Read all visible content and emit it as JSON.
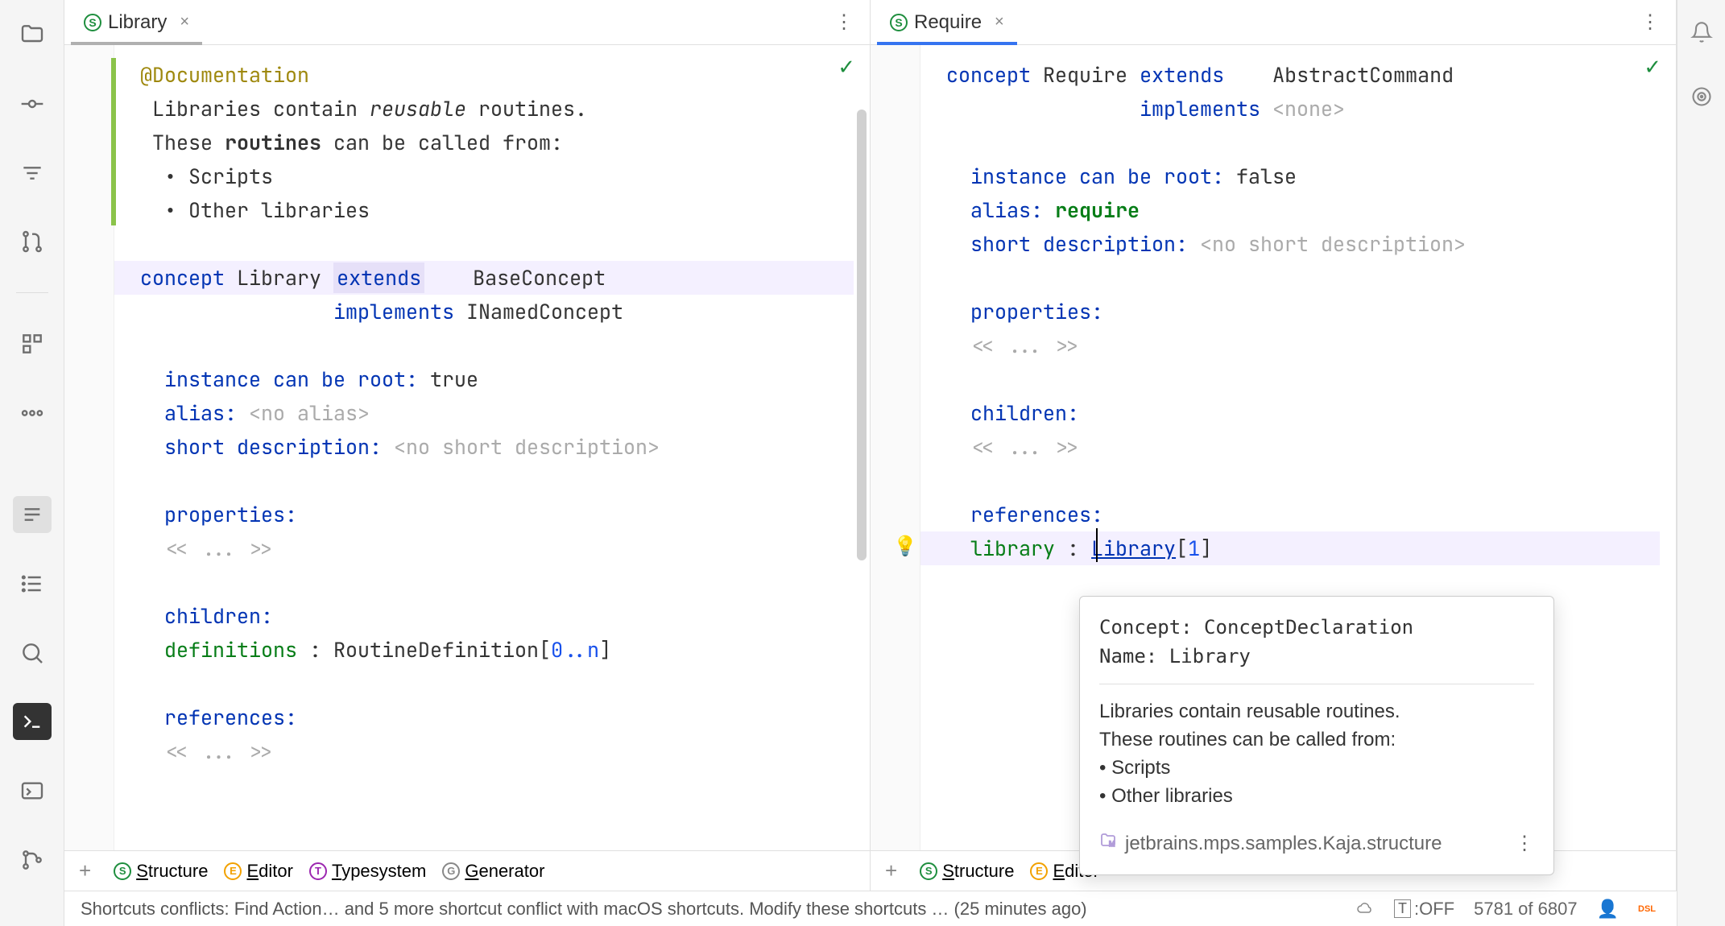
{
  "tabs": {
    "left": {
      "title": "Library",
      "icon": "S"
    },
    "right": {
      "title": "Require",
      "icon": "S"
    }
  },
  "left_editor": {
    "doc_annotation": "@Documentation",
    "doc_line1_pre": "Libraries contain ",
    "doc_line1_em": "reusable",
    "doc_line1_post": " routines.",
    "doc_line2_pre": "These ",
    "doc_line2_b": "routines",
    "doc_line2_post": " can be called from:",
    "doc_bullet1": "• Scripts",
    "doc_bullet2": "• Other libraries",
    "concept_kw": "concept",
    "concept_name": "Library",
    "extends_kw": "extends",
    "extends_val": "BaseConcept",
    "implements_kw": "implements",
    "implements_val": "INamedConcept",
    "root_label": "instance can be root:",
    "root_val": "true",
    "alias_label": "alias:",
    "alias_val": "<no alias>",
    "desc_label": "short description:",
    "desc_val": "<no short description>",
    "props_label": "properties:",
    "ellipsis": "<< ... >>",
    "children_label": "children:",
    "child_name": "definitions",
    "child_type": "RoutineDefinition",
    "child_card_open": "[",
    "child_card": "0..n",
    "child_card_close": "]",
    "refs_label": "references:"
  },
  "right_editor": {
    "concept_kw": "concept",
    "concept_name": "Require",
    "extends_kw": "extends",
    "extends_val": "AbstractCommand",
    "implements_kw": "implements",
    "implements_val": "<none>",
    "root_label": "instance can be root:",
    "root_val": "false",
    "alias_label": "alias:",
    "alias_val": "require",
    "desc_label": "short description:",
    "desc_val": "<no short description>",
    "props_label": "properties:",
    "ellipsis": "<< ... >>",
    "children_label": "children:",
    "refs_label": "references:",
    "ref_name": "library",
    "ref_type": "Library",
    "ref_card_open": "[",
    "ref_card": "1",
    "ref_card_close": "]"
  },
  "aspects": {
    "structure": "tructure",
    "structure_pre": "S",
    "editor": "ditor",
    "editor_pre": "E",
    "typesystem": "ypesystem",
    "typesystem_pre": "T",
    "generator": "enerator",
    "generator_pre": "G"
  },
  "popup": {
    "concept_label": "Concept:",
    "concept_val": "ConceptDeclaration",
    "name_label": "Name:",
    "name_val": "Library",
    "body1": "Libraries contain reusable routines.",
    "body2": "These routines can be called from:",
    "bullet1": "• Scripts",
    "bullet2": "• Other libraries",
    "location": "jetbrains.mps.samples.Kaja.structure"
  },
  "statusbar": {
    "msg": "Shortcuts conflicts: Find Action… and 5 more shortcut conflict with macOS shortcuts. Modify these shortcuts … (25 minutes ago)",
    "toff": ":OFF",
    "chars": "5781 of 6807"
  }
}
